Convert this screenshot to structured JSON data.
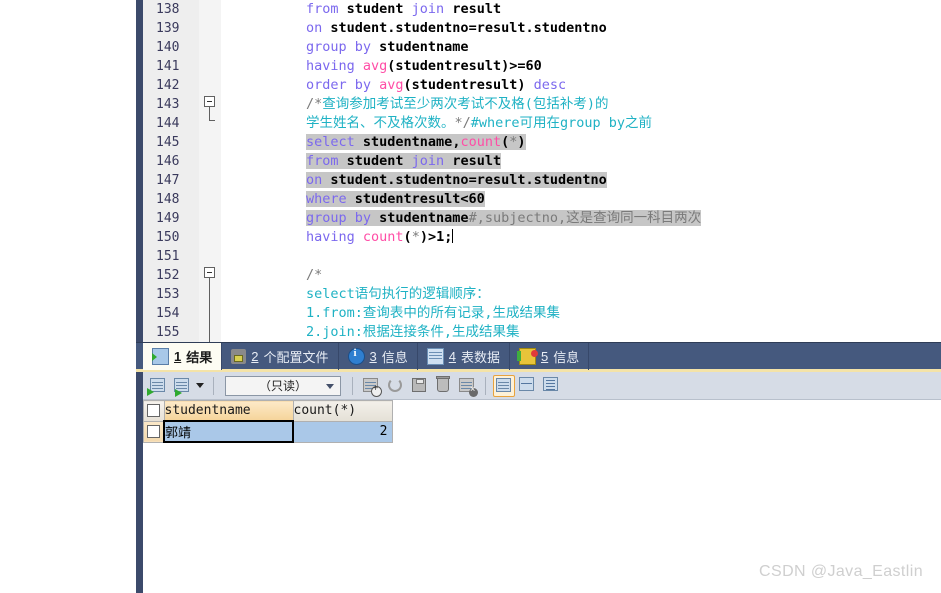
{
  "editor": {
    "lines": [
      {
        "num": "138",
        "segments": [
          {
            "t": "from",
            "c": "kw"
          },
          {
            "t": " student ",
            "c": "id"
          },
          {
            "t": "join",
            "c": "kw"
          },
          {
            "t": " result",
            "c": "id"
          }
        ],
        "highlight": false
      },
      {
        "num": "139",
        "segments": [
          {
            "t": "on",
            "c": "kw"
          },
          {
            "t": " student.studentno=result.studentno",
            "c": "id"
          }
        ],
        "highlight": false
      },
      {
        "num": "140",
        "segments": [
          {
            "t": "group by",
            "c": "kw"
          },
          {
            "t": " studentname",
            "c": "id"
          }
        ],
        "highlight": false
      },
      {
        "num": "141",
        "segments": [
          {
            "t": "having ",
            "c": "kw"
          },
          {
            "t": "avg",
            "c": "fn"
          },
          {
            "t": "(studentresult)>=60",
            "c": "id"
          }
        ],
        "highlight": false
      },
      {
        "num": "142",
        "segments": [
          {
            "t": "order by ",
            "c": "kw"
          },
          {
            "t": "avg",
            "c": "fn"
          },
          {
            "t": "(studentresult) ",
            "c": "id"
          },
          {
            "t": "desc",
            "c": "kw"
          }
        ],
        "highlight": false
      },
      {
        "num": "143",
        "segments": [
          {
            "t": "/*",
            "c": "cmt2"
          },
          {
            "t": "查询参加考试至少两次考试不及格(包括补考)的",
            "c": "cmt"
          }
        ],
        "highlight": false
      },
      {
        "num": "144",
        "segments": [
          {
            "t": "学生姓名、不及格次数。",
            "c": "cmt"
          },
          {
            "t": "*/",
            "c": "cmt2"
          },
          {
            "t": "#where可用在group by之前",
            "c": "cmt"
          }
        ],
        "highlight": false
      },
      {
        "num": "145",
        "segments": [
          {
            "t": "select",
            "c": "kw"
          },
          {
            "t": " studentname,",
            "c": "id"
          },
          {
            "t": "count",
            "c": "fn"
          },
          {
            "t": "(",
            "c": "id"
          },
          {
            "t": "*",
            "c": "cmt2"
          },
          {
            "t": ")",
            "c": "id"
          }
        ],
        "highlight": true
      },
      {
        "num": "146",
        "segments": [
          {
            "t": "from",
            "c": "kw"
          },
          {
            "t": " student ",
            "c": "id"
          },
          {
            "t": "join",
            "c": "kw"
          },
          {
            "t": " result",
            "c": "id"
          }
        ],
        "highlight": true
      },
      {
        "num": "147",
        "segments": [
          {
            "t": "on",
            "c": "kw"
          },
          {
            "t": " student.studentno=result.studentno",
            "c": "id"
          }
        ],
        "highlight": true
      },
      {
        "num": "148",
        "segments": [
          {
            "t": "where",
            "c": "kw"
          },
          {
            "t": " studentresult<60",
            "c": "id"
          }
        ],
        "highlight": true
      },
      {
        "num": "149",
        "segments": [
          {
            "t": "group by",
            "c": "kw"
          },
          {
            "t": " studentname",
            "c": "id"
          },
          {
            "t": "#,subjectno,这是查询同一科目两次",
            "c": "cmt2"
          }
        ],
        "highlight": true
      },
      {
        "num": "150",
        "segments": [
          {
            "t": "having ",
            "c": "kw"
          },
          {
            "t": "count",
            "c": "fn"
          },
          {
            "t": "(",
            "c": "id"
          },
          {
            "t": "*",
            "c": "cmt2"
          },
          {
            "t": ")>1;",
            "c": "id"
          }
        ],
        "highlight": false,
        "caret": true
      },
      {
        "num": "151",
        "segments": [],
        "highlight": false
      },
      {
        "num": "152",
        "segments": [
          {
            "t": "/*",
            "c": "cmt2"
          }
        ],
        "highlight": false
      },
      {
        "num": "153",
        "segments": [
          {
            "t": "        select语句执行的逻辑顺序：",
            "c": "cmt"
          }
        ],
        "highlight": false
      },
      {
        "num": "154",
        "segments": [
          {
            "t": "        1.from:查询表中的所有记录,生成结果集",
            "c": "cmt"
          }
        ],
        "highlight": false
      },
      {
        "num": "155",
        "segments": [
          {
            "t": "        2.join:根据连接条件,生成结果集",
            "c": "cmt"
          }
        ],
        "highlight": false
      }
    ]
  },
  "results": {
    "tabs": [
      {
        "num": "1",
        "label": "结果",
        "icon": "result-grid-icon",
        "active": true
      },
      {
        "num": "2",
        "label": "个配置文件",
        "icon": "profile-icon",
        "active": false
      },
      {
        "num": "3",
        "label": "信息",
        "icon": "info-icon",
        "active": false
      },
      {
        "num": "4",
        "label": "表数据",
        "icon": "table-data-icon",
        "active": false
      },
      {
        "num": "5",
        "label": "信息",
        "icon": "message-icon",
        "active": false
      }
    ],
    "toolbar": {
      "buttons": [
        {
          "name": "insert-record-icon",
          "kind": "grid-arrow"
        },
        {
          "name": "insert-record-dropdown-icon",
          "kind": "grid-arrow-drop"
        }
      ],
      "mode_select": {
        "value": "（只读）",
        "name": "readonly-mode-select"
      },
      "actions": [
        {
          "name": "add-record-icon",
          "kind": "grid-plus"
        },
        {
          "name": "refresh-icon",
          "kind": "refresh"
        },
        {
          "name": "save-icon",
          "kind": "floppy"
        },
        {
          "name": "delete-record-icon",
          "kind": "trash"
        },
        {
          "name": "cancel-changes-icon",
          "kind": "grid-x"
        }
      ],
      "views": [
        {
          "name": "grid-view-button",
          "kind": "grid-lines",
          "active": true
        },
        {
          "name": "form-view-button",
          "kind": "grid-halves",
          "active": false
        },
        {
          "name": "text-view-button",
          "kind": "grid-text",
          "active": false
        }
      ]
    },
    "grid": {
      "columns": [
        "studentname",
        "count(*)"
      ],
      "rows": [
        {
          "studentname": "郭靖",
          "count": "2"
        }
      ]
    }
  },
  "watermark": "CSDN @Java_Eastlin"
}
